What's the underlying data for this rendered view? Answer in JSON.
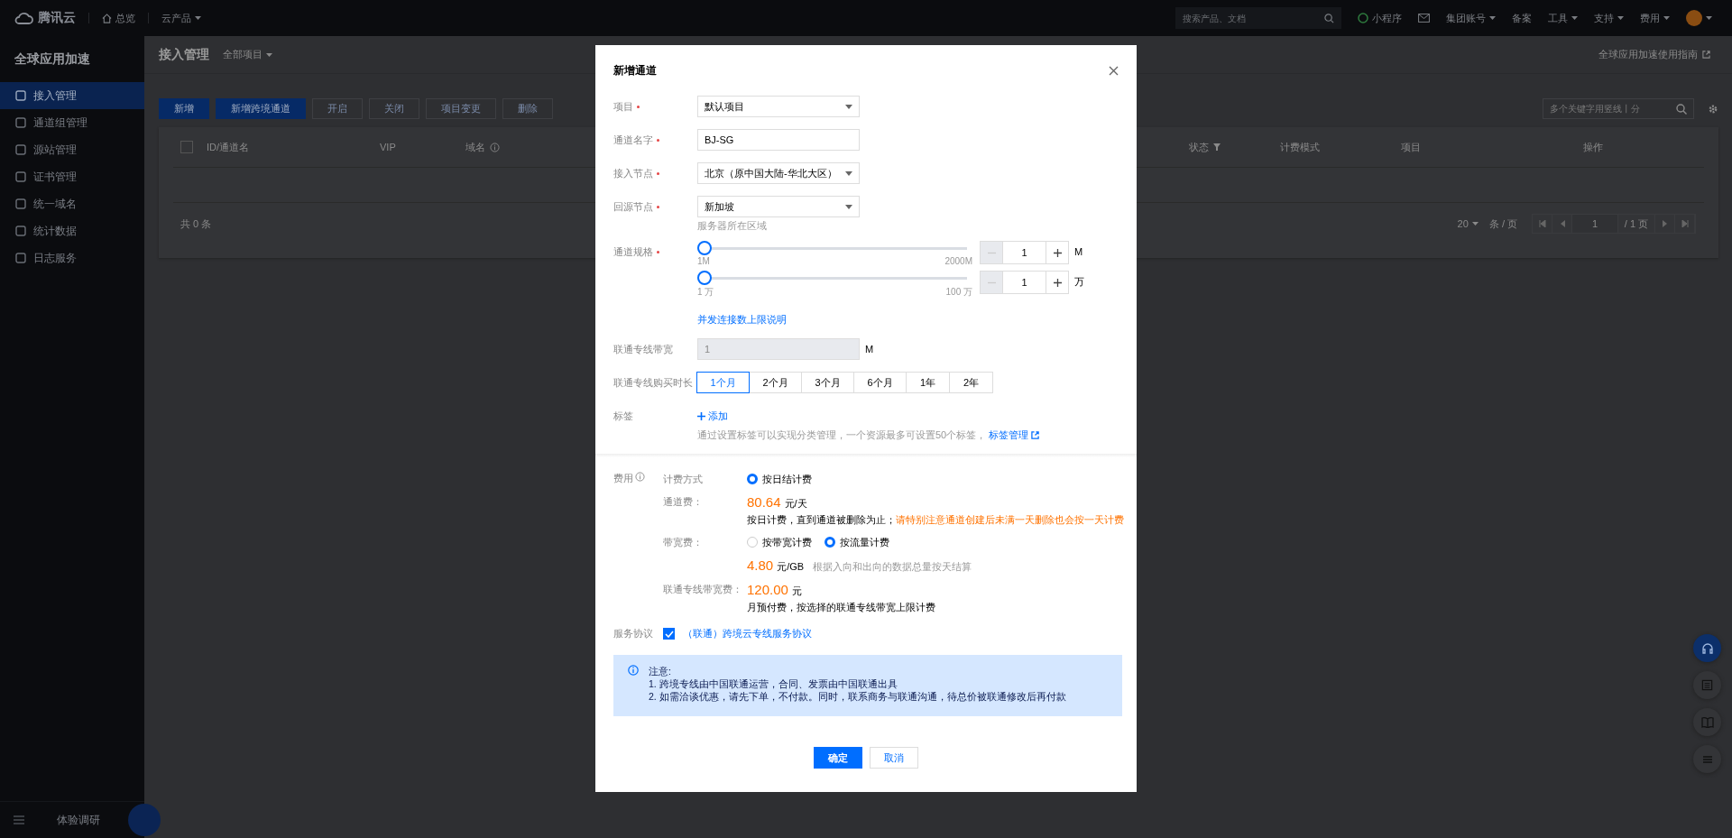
{
  "top_bar": {
    "logo": "腾讯云",
    "nav": [
      {
        "label": "总览",
        "kind": "home"
      },
      {
        "label": "云产品",
        "kind": "dropdown"
      }
    ],
    "search": {
      "placeholder": "搜索产品、文档"
    },
    "right_items": [
      {
        "label": "小程序",
        "kind": "badge"
      },
      {
        "kind": "mail"
      },
      {
        "label": "集团账号",
        "kind": "dropdown"
      },
      {
        "label": "备案",
        "kind": "plain"
      },
      {
        "label": "工具",
        "kind": "dropdown"
      },
      {
        "label": "支持",
        "kind": "dropdown"
      },
      {
        "label": "费用",
        "kind": "dropdown"
      }
    ]
  },
  "sidebar": {
    "title": "全球应用加速",
    "items": [
      {
        "label": "接入管理",
        "selected": true
      },
      {
        "label": "通道组管理",
        "selected": false
      },
      {
        "label": "源站管理",
        "selected": false
      },
      {
        "label": "证书管理",
        "selected": false
      },
      {
        "label": "统一域名",
        "selected": false
      },
      {
        "label": "统计数据",
        "selected": false
      },
      {
        "label": "日志服务",
        "selected": false
      }
    ],
    "footer": "体验调研"
  },
  "page": {
    "title": "接入管理",
    "project_filter": "全部项目",
    "guide_link": "全球应用加速使用指南",
    "toolbar": [
      {
        "label": "新增",
        "kind": "primary"
      },
      {
        "label": "新增跨境通道",
        "kind": "primary"
      },
      {
        "label": "开启",
        "kind": "default"
      },
      {
        "label": "关闭",
        "kind": "default"
      },
      {
        "label": "项目变更",
        "kind": "default"
      },
      {
        "label": "删除",
        "kind": "default"
      }
    ],
    "search": {
      "placeholder": "多个关键字用竖线丨分"
    },
    "table": {
      "select_all_checked": false,
      "columns": [
        {
          "label": "ID/通道名",
          "kind": "check"
        },
        {
          "label": "VIP",
          "kind": "plain"
        },
        {
          "label": "域名",
          "kind": "info"
        },
        {
          "label": "状态",
          "kind": "filter"
        },
        {
          "label": "计费模式",
          "kind": "plain"
        },
        {
          "label": "项目",
          "kind": "plain"
        },
        {
          "label": "操作",
          "kind": "plain"
        }
      ],
      "total": "共 0 条",
      "page_size": "20",
      "per_page": "条 / 页",
      "page": "1",
      "pages": "/ 1 页"
    }
  },
  "dialog": {
    "title": "新增通道",
    "fields": [
      {
        "kind": "select",
        "label": "项目",
        "required": true,
        "value": "默认项目"
      },
      {
        "kind": "input",
        "label": "通道名字",
        "required": true,
        "value": "BJ-SG"
      },
      {
        "kind": "select",
        "label": "接入节点",
        "required": true,
        "value": "北京（原中国大陆-华北大区）"
      },
      {
        "kind": "select",
        "label": "回源节点",
        "required": true,
        "value": "新加坡",
        "help": "服务器所在区域"
      },
      {
        "kind": "sliders",
        "label": "通道规格",
        "required": true,
        "link": "并发连接数上限说明",
        "sliders": [
          {
            "level": 0,
            "min": "1M",
            "max": "2000M",
            "value": "1",
            "unit": "M",
            "decrement_disabled": true
          },
          {
            "level": 0,
            "min": "1 万",
            "max": "100 万",
            "value": "1",
            "unit": "万",
            "decrement_disabled": true
          }
        ]
      },
      {
        "kind": "disabled",
        "label": "联通专线带宽",
        "value": "1",
        "unit": "M"
      },
      {
        "kind": "segmented",
        "label": "联通专线购买时长",
        "options": [
          {
            "label": "1个月",
            "selected": true
          },
          {
            "label": "2个月",
            "selected": false
          },
          {
            "label": "3个月",
            "selected": false
          },
          {
            "label": "6个月",
            "selected": false
          },
          {
            "label": "1年",
            "selected": false
          },
          {
            "label": "2年",
            "selected": false
          }
        ]
      },
      {
        "kind": "tags",
        "label": "标签",
        "add": "添加",
        "hint": "通过设置标签可以实现分类管理，一个资源最多可设置50个标签，",
        "link": "标签管理"
      }
    ],
    "fee": {
      "label": "费用",
      "rows": [
        {
          "kind": "radio",
          "label": "计费方式",
          "options": [
            {
              "label": "按日结计费",
              "selected": true
            }
          ]
        },
        {
          "kind": "price",
          "label": "通道费：",
          "price": "80.64",
          "unit": "元/天",
          "note": "按日计费，直到通道被删除为止；",
          "warning": "请特别注意通道创建后未满一天删除也会按一天计费"
        },
        {
          "kind": "radio",
          "label": "带宽费：",
          "options": [
            {
              "label": "按带宽计费",
              "selected": false
            },
            {
              "label": "按流量计费",
              "selected": true
            }
          ]
        },
        {
          "kind": "price",
          "price": "4.80",
          "unit": "元/GB",
          "inline_note": "根据入向和出向的数据总量按天结算"
        },
        {
          "kind": "price",
          "label": "联通专线带宽费：",
          "price": "120.00",
          "unit": "元",
          "note": "月预付费，按选择的联通专线带宽上限计费"
        }
      ]
    },
    "agreement": {
      "label": "服务协议",
      "checked": true,
      "link": "（联通）跨境云专线服务协议"
    },
    "notice": {
      "title": "注意:",
      "lines": [
        "1. 跨境专线由中国联通运营，合同、发票由中国联通出具",
        "2. 如需洽谈优惠，请先下单，不付款。同时，联系商务与联通沟通，待总价被联通修改后再付款"
      ]
    },
    "buttons": [
      {
        "label": "确定",
        "kind": "primary"
      },
      {
        "label": "取消",
        "kind": "default"
      }
    ]
  }
}
